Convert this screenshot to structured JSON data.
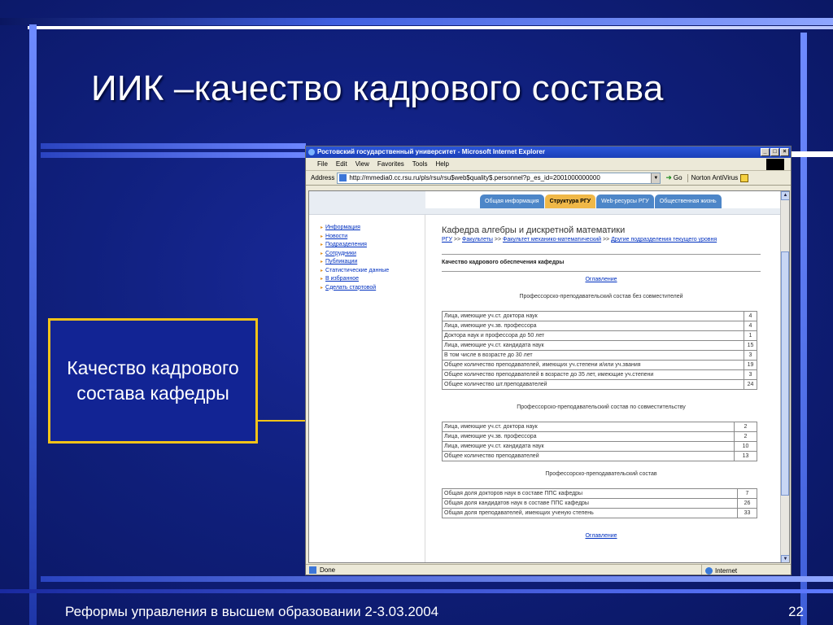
{
  "slide": {
    "title": "ИИК –качество кадрового состава",
    "callout": "Качество кадрового состава кафедры",
    "footer": "Реформы управления в высшем образовании 2-3.03.2004",
    "page_number": "22"
  },
  "browser": {
    "title": "Ростовский государственный университет - Microsoft Internet Explorer",
    "menu": [
      "File",
      "Edit",
      "View",
      "Favorites",
      "Tools",
      "Help"
    ],
    "address_label": "Address",
    "address_value": "http://mmedia0.cc.rsu.ru/pls/rsu/rsu$web$quality$.personnel?p_es_id=2001000000000",
    "go_label": "Go",
    "norton_label": "Norton AntiVirus",
    "status_text": "Done",
    "status_zone": "Internet"
  },
  "page": {
    "tabs": [
      "Общая информация",
      "Структура РГУ",
      "Web-ресурсы РГУ",
      "Общественная жизнь"
    ],
    "left_menu": [
      "Информация",
      "Новости",
      "Подразделения",
      "Сотрудники",
      "Публикации",
      "Статистические данные",
      "В избранное",
      "Сделать стартовой"
    ],
    "heading": "Кафедра алгебры и дискретной математики",
    "breadcrumbs": {
      "rgu": "РГУ",
      "sep": ">>",
      "faculties": "Факультеты",
      "mechmat": "Факультет механико-математический",
      "other": "Другие подразделения текущего уровня"
    },
    "subheading": "Качество кадрового обеспечения кафедры",
    "toc_label": "Оглавление",
    "section1": {
      "title": "Профессорско-преподавательский состав без совместителей",
      "rows": [
        {
          "label": "Лица, имеющие уч.ст. доктора наук",
          "value": "4"
        },
        {
          "label": "Лица, имеющие уч.зв. профессора",
          "value": "4"
        },
        {
          "label": "Доктора наук и профессора до 50 лет",
          "value": "1"
        },
        {
          "label": "Лица, имеющие уч.ст. кандидата наук",
          "value": "15"
        },
        {
          "label": "В том числе в возрасте до 30 лет",
          "value": "3"
        },
        {
          "label": "Общее количество преподавателей, имеющих уч.степени и/или уч.звания",
          "value": "19"
        },
        {
          "label": "Общее количество преподавателей в возрасте до 35 лет, имеющие уч.степени",
          "value": "3"
        },
        {
          "label": "Общее количество шт.преподавателей",
          "value": "24"
        }
      ]
    },
    "section2": {
      "title": "Профессорско-преподавательский состав по совместительству",
      "rows": [
        {
          "label": "Лица, имеющие уч.ст. доктора наук",
          "value": "2"
        },
        {
          "label": "Лица, имеющие уч.зв. профессора",
          "value": "2"
        },
        {
          "label": "Лица, имеющие уч.ст. кандидата наук",
          "value": "10"
        },
        {
          "label": "Общее количество преподавателей",
          "value": "13"
        }
      ]
    },
    "section3": {
      "title": "Профессорско-преподавательский состав",
      "rows": [
        {
          "label": "Общая доля докторов наук в составе ППС кафедры",
          "value": "7"
        },
        {
          "label": "Общая доля кандидатов наук в составе ППС кафедры",
          "value": "26"
        },
        {
          "label": "Общая доля преподавателей, имеющих ученую степень",
          "value": "33"
        }
      ]
    }
  },
  "colors": {
    "slide_background": "#10207e",
    "accent_yellow": "#f2c318",
    "tab_blue": "#4d86c8",
    "tab_active": "#f0b848",
    "link_blue": "#0030c0"
  }
}
